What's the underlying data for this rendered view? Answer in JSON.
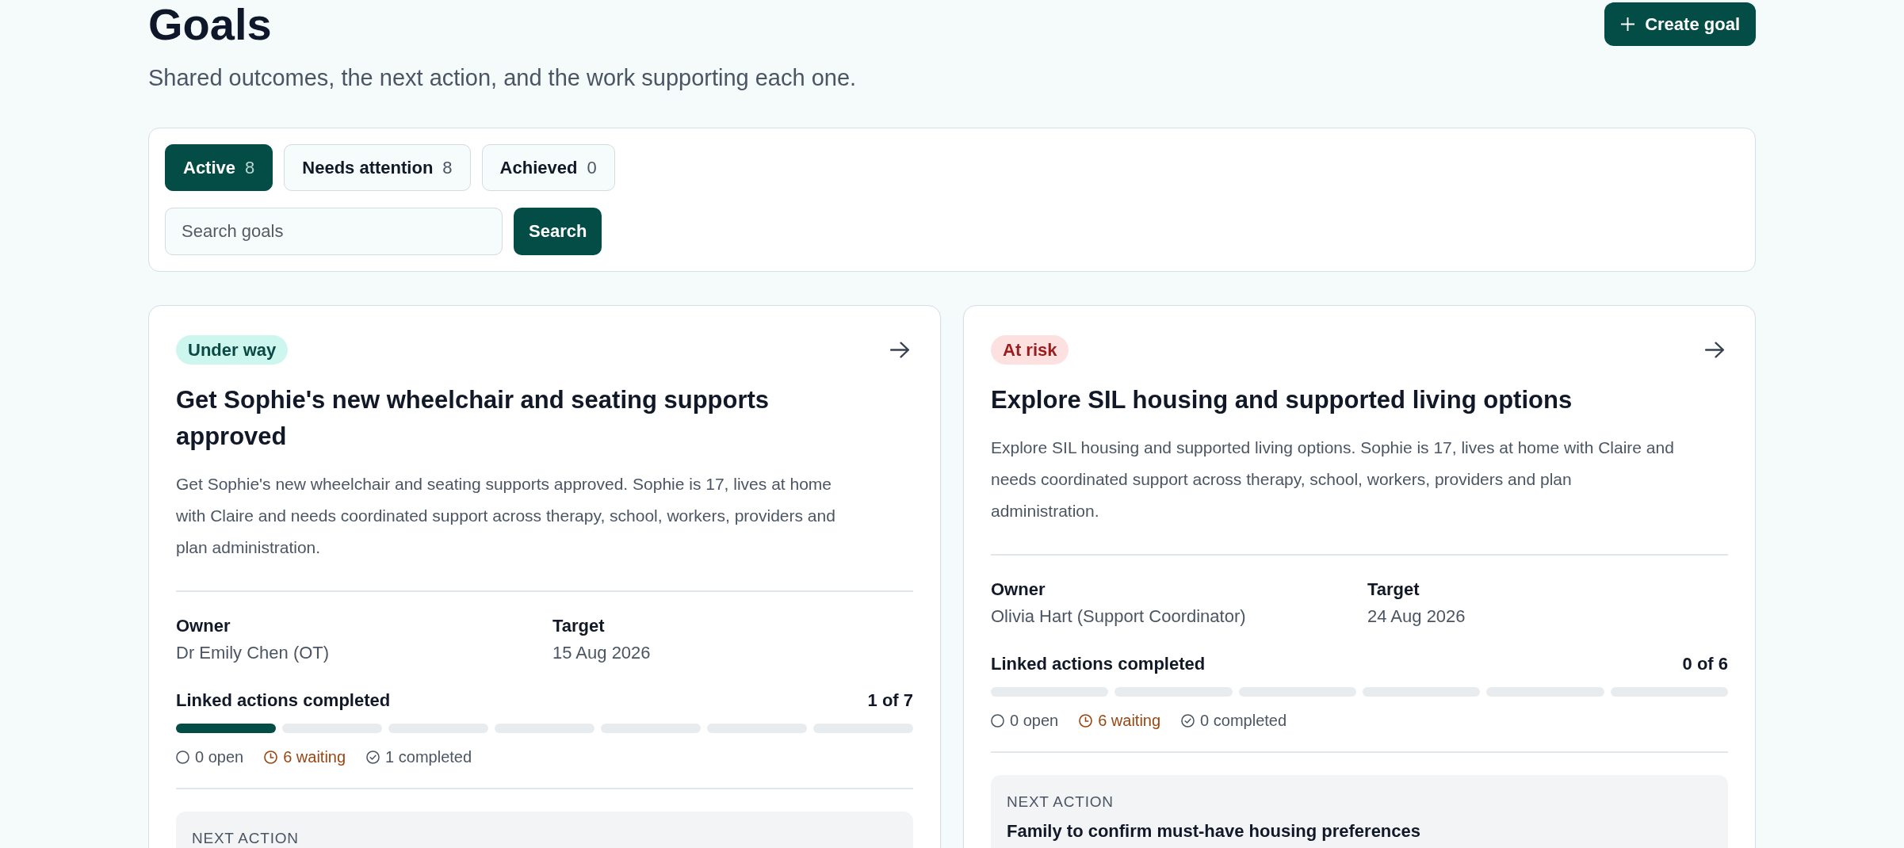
{
  "header": {
    "title": "Goals",
    "subtitle": "Shared outcomes, the next action, and the work supporting each one.",
    "create_button": "Create goal"
  },
  "filters": {
    "tabs": [
      {
        "label": "Active",
        "count": "8",
        "selected": true
      },
      {
        "label": "Needs attention",
        "count": "8",
        "selected": false
      },
      {
        "label": "Achieved",
        "count": "0",
        "selected": false
      }
    ],
    "search": {
      "placeholder": "Search goals",
      "button": "Search"
    }
  },
  "goals": [
    {
      "status": {
        "label": "Under way",
        "kind": "under_way"
      },
      "title": "Get Sophie's new wheelchair and seating supports approved",
      "description": "Get Sophie's new wheelchair and seating supports approved. Sophie is 17, lives at home with Claire and needs coordinated support across therapy, school, workers, providers and plan administration.",
      "fields": [
        {
          "label": "Owner",
          "value": "Dr Emily Chen (OT)"
        },
        {
          "label": "Target",
          "value": "15 Aug 2026"
        }
      ],
      "progress": {
        "label": "Linked actions completed",
        "count": "1 of 7",
        "segments": [
          {
            "filled": true
          },
          {
            "filled": false
          },
          {
            "filled": false
          },
          {
            "filled": false
          },
          {
            "filled": false
          },
          {
            "filled": false
          },
          {
            "filled": false
          }
        ]
      },
      "stats": [
        {
          "kind": "open",
          "text": "0 open"
        },
        {
          "kind": "waiting",
          "text": "6 waiting"
        },
        {
          "kind": "completed",
          "text": "1 completed"
        }
      ],
      "next_action": {
        "label": "NEXT ACTION"
      }
    },
    {
      "status": {
        "label": "At risk",
        "kind": "at_risk"
      },
      "title": "Explore SIL housing and supported living options",
      "description": "Explore SIL housing and supported living options. Sophie is 17, lives at home with Claire and needs coordinated support across therapy, school, workers, providers and plan administration.",
      "fields": [
        {
          "label": "Owner",
          "value": "Olivia Hart (Support Coordinator)"
        },
        {
          "label": "Target",
          "value": "24 Aug 2026"
        }
      ],
      "progress": {
        "label": "Linked actions completed",
        "count": "0 of 6",
        "segments": [
          {
            "filled": false
          },
          {
            "filled": false
          },
          {
            "filled": false
          },
          {
            "filled": false
          },
          {
            "filled": false
          },
          {
            "filled": false
          }
        ]
      },
      "stats": [
        {
          "kind": "open",
          "text": "0 open"
        },
        {
          "kind": "waiting",
          "text": "6 waiting"
        },
        {
          "kind": "completed",
          "text": "0 completed"
        }
      ],
      "next_action": {
        "label": "NEXT ACTION",
        "title": "Family to confirm must-have housing preferences"
      }
    }
  ]
}
